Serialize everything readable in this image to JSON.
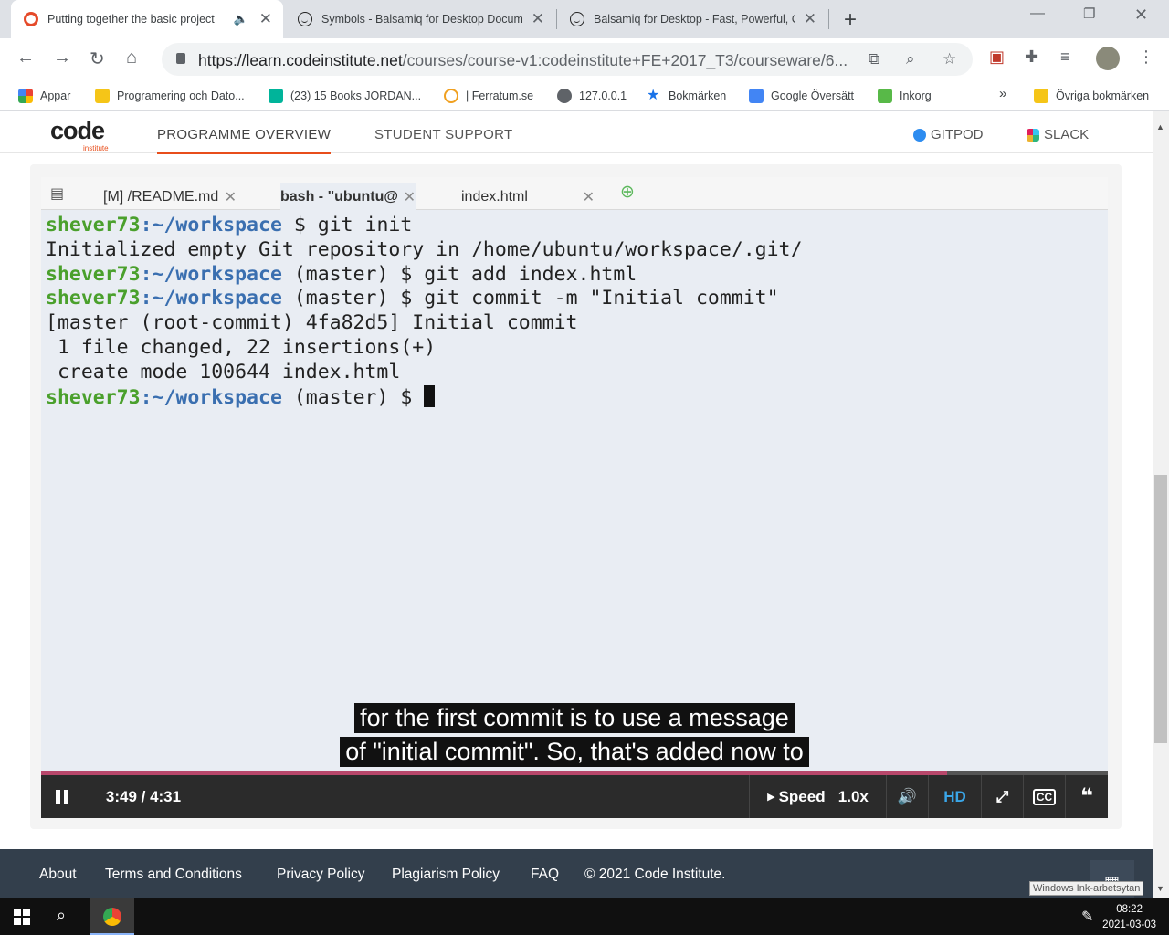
{
  "browser": {
    "tabs": [
      {
        "title": "Putting together the basic project",
        "active": true
      },
      {
        "title": "Symbols - Balsamiq for Desktop Documentation",
        "active": false
      },
      {
        "title": "Balsamiq for Desktop - Fast, Powerful, Customizable",
        "active": false
      }
    ],
    "url_host": "https://learn.codeinstitute.net",
    "url_path": "/courses/course-v1:codeinstitute+FE+2017_T3/courseware/6...",
    "bookmarks": [
      "Appar",
      "Programering och Dato...",
      "(23) 15 Books JORDAN...",
      "| Ferratum.se",
      "127.0.0.1",
      "Bokmärken",
      "Google Översätt",
      "Inkorg",
      "Övriga bokmärken"
    ],
    "bookmarks_more": "»"
  },
  "site": {
    "logo_main": "code",
    "logo_sub": "institute",
    "nav": [
      "PROGRAMME OVERVIEW",
      "STUDENT SUPPORT"
    ],
    "nav_right": [
      "GITPOD",
      "SLACK"
    ]
  },
  "video": {
    "ide_tabs": [
      "[M] /README.md",
      "bash - \"ubuntu@",
      "index.html"
    ],
    "terminal": [
      {
        "user": "shever73",
        "path": ":~/workspace",
        "rest": " $ git init"
      },
      {
        "text": "Initialized empty Git repository in /home/ubuntu/workspace/.git/"
      },
      {
        "user": "shever73",
        "path": ":~/workspace",
        "rest": " (master) $ git add index.html"
      },
      {
        "user": "shever73",
        "path": ":~/workspace",
        "rest": " (master) $ git commit -m \"Initial commit\""
      },
      {
        "text": "[master (root-commit) 4fa82d5] Initial commit"
      },
      {
        "text": " 1 file changed, 22 insertions(+)"
      },
      {
        "text": " create mode 100644 index.html"
      },
      {
        "user": "shever73",
        "path": ":~/workspace",
        "rest": " (master) $ ",
        "cursor": true
      }
    ],
    "caption_line1": "for the first commit is to use a message",
    "caption_line2": "of \"initial commit\". So, that's added now to",
    "time": "3:49 / 4:31",
    "progress": 0.849,
    "speed_label": "Speed",
    "speed_value": "1.0x",
    "hd_label": "HD",
    "accent": "#b8476b"
  },
  "footer": {
    "links": [
      "About",
      "Terms and Conditions",
      "Privacy Policy",
      "Plagiarism Policy",
      "FAQ",
      "© 2021 Code Institute."
    ]
  },
  "overlay_tooltip": "Windows Ink-arbetsytan",
  "taskbar": {
    "time": "08:22",
    "date": "2021-03-03"
  }
}
